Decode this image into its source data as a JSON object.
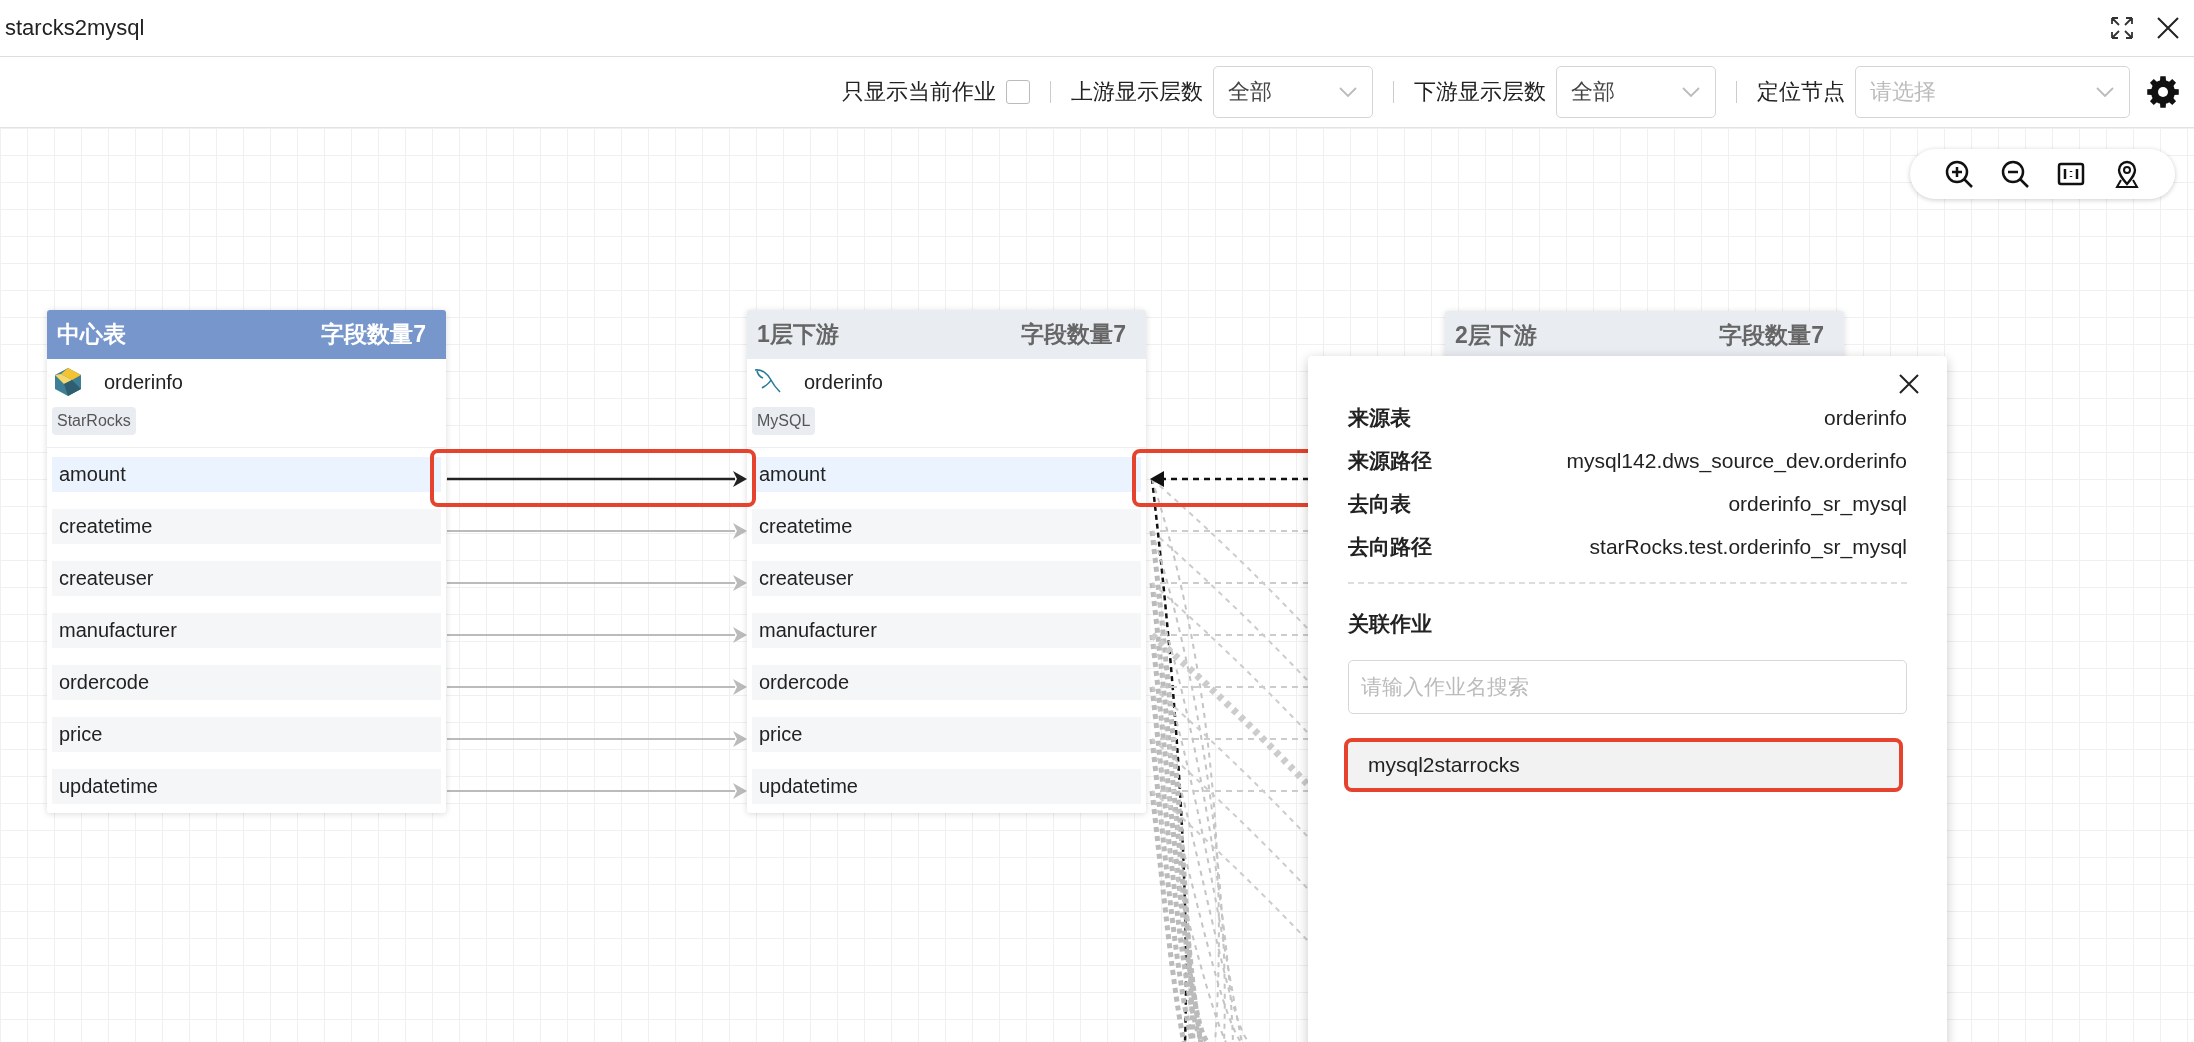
{
  "window": {
    "title": "starcks2mysql"
  },
  "toolbar": {
    "current_job_only": {
      "label": "只显示当前作业",
      "checked": false
    },
    "upstream": {
      "label": "上游显示层数",
      "value": "全部"
    },
    "downstream": {
      "label": "下游显示层数",
      "value": "全部"
    },
    "locate": {
      "label": "定位节点",
      "placeholder": "请选择"
    }
  },
  "nodes": [
    {
      "header": "中心表",
      "count": "字段数量7",
      "selected": true,
      "kind": "starrocks",
      "name": "orderinfo",
      "tag": "StarRocks",
      "fields": [
        {
          "name": "amount",
          "selected": true
        },
        {
          "name": "createtime",
          "selected": false
        },
        {
          "name": "createuser",
          "selected": false
        },
        {
          "name": "manufacturer",
          "selected": false
        },
        {
          "name": "ordercode",
          "selected": false
        },
        {
          "name": "price",
          "selected": false
        },
        {
          "name": "updatetime",
          "selected": false
        }
      ]
    },
    {
      "header": "1层下游",
      "count": "字段数量7",
      "selected": false,
      "kind": "mysql",
      "name": "orderinfo",
      "tag": "MySQL",
      "fields": [
        {
          "name": "amount",
          "selected": true
        },
        {
          "name": "createtime",
          "selected": false
        },
        {
          "name": "createuser",
          "selected": false
        },
        {
          "name": "manufacturer",
          "selected": false
        },
        {
          "name": "ordercode",
          "selected": false
        },
        {
          "name": "price",
          "selected": false
        },
        {
          "name": "updatetime",
          "selected": false
        }
      ]
    },
    {
      "header": "2层下游",
      "count": "字段数量7",
      "selected": false
    }
  ],
  "popup": {
    "rows": [
      {
        "label": "来源表",
        "value": "orderinfo"
      },
      {
        "label": "来源路径",
        "value": "mysql142.dws_source_dev.orderinfo"
      },
      {
        "label": "去向表",
        "value": "orderinfo_sr_mysql"
      },
      {
        "label": "去向路径",
        "value": "starRocks.test.orderinfo_sr_mysql"
      }
    ],
    "section": "关联作业",
    "search": {
      "placeholder": "请输入作业名搜索"
    },
    "jobs": [
      {
        "name": "mysql2starrocks",
        "selected": true
      }
    ]
  }
}
